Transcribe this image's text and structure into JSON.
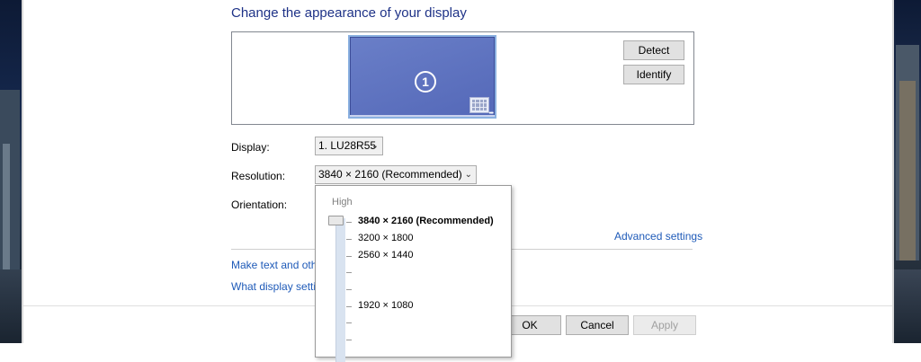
{
  "title": "Change the appearance of your display",
  "monitor": {
    "number": "1"
  },
  "buttons": {
    "detect": "Detect",
    "identify": "Identify",
    "ok": "OK",
    "cancel": "Cancel",
    "apply": "Apply"
  },
  "display": {
    "label": "Display:",
    "value": "1. LU28R55"
  },
  "resolution": {
    "label": "Resolution:",
    "value": "3840 × 2160 (Recommended)"
  },
  "orientation": {
    "label": "Orientation:"
  },
  "links": {
    "advanced": "Advanced settings",
    "make_text": "Make text and othe",
    "what_display": "What display setting"
  },
  "resolution_dropdown": {
    "high_label": "High",
    "options": [
      {
        "label": "3840 × 2160 (Recommended)",
        "selected": true
      },
      {
        "label": "3200 × 1800",
        "selected": false
      },
      {
        "label": "2560 × 1440",
        "selected": false
      },
      {
        "label": "1920 × 1080",
        "selected": false
      }
    ]
  },
  "icons": {
    "dropdown_chevron": "chevron-down-icon",
    "display_icon": "monitor-icon"
  }
}
